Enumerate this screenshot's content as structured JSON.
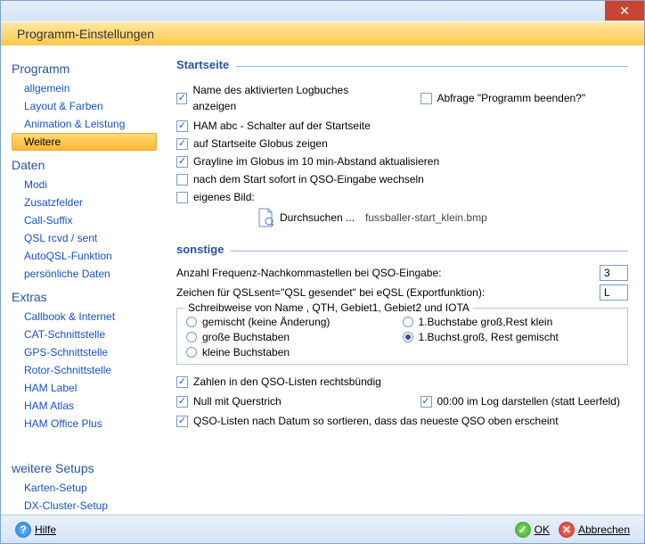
{
  "window": {
    "title": "Programm-Einstellungen"
  },
  "sidebar": {
    "groups": [
      {
        "heading": "Programm",
        "items": [
          {
            "label": "allgemein",
            "selected": false
          },
          {
            "label": "Layout & Farben",
            "selected": false
          },
          {
            "label": "Animation & Leistung",
            "selected": false
          },
          {
            "label": "Weitere",
            "selected": true
          }
        ]
      },
      {
        "heading": "Daten",
        "items": [
          {
            "label": "Modi"
          },
          {
            "label": "Zusatzfelder"
          },
          {
            "label": "Call-Suffix"
          },
          {
            "label": "QSL rcvd / sent"
          },
          {
            "label": "AutoQSL-Funktion"
          },
          {
            "label": "persönliche Daten"
          }
        ]
      },
      {
        "heading": "Extras",
        "items": [
          {
            "label": "Callbook & Internet"
          },
          {
            "label": "CAT-Schnittstelle"
          },
          {
            "label": "GPS-Schnittstelle"
          },
          {
            "label": "Rotor-Schnittstelle"
          },
          {
            "label": "HAM Label"
          },
          {
            "label": "HAM Atlas"
          },
          {
            "label": "HAM Office Plus"
          }
        ]
      },
      {
        "heading": "weitere Setups",
        "items": [
          {
            "label": "Karten-Setup"
          },
          {
            "label": "DX-Cluster-Setup"
          }
        ]
      }
    ]
  },
  "sections": {
    "startseite_title": "Startseite",
    "sonstige_title": "sonstige"
  },
  "startseite": {
    "chk_logbuch": {
      "label": "Name des aktivierten Logbuches anzeigen",
      "checked": true
    },
    "chk_beenden": {
      "label": "Abfrage \"Programm beenden?\"",
      "checked": false
    },
    "chk_hamabc": {
      "label": "HAM abc - Schalter auf der Startseite",
      "checked": true
    },
    "chk_globus": {
      "label": "auf Startseite Globus zeigen",
      "checked": true
    },
    "chk_grayline": {
      "label": "Grayline im Globus im 10 min-Abstand aktualisieren",
      "checked": true
    },
    "chk_qsoeingabe": {
      "label": "nach dem Start sofort in QSO-Eingabe wechseln",
      "checked": false
    },
    "chk_eigenesbild": {
      "label": "eigenes Bild:",
      "checked": false
    },
    "file": {
      "browse_label": "Durchsuchen ...",
      "filename": "fussballer-start_klein.bmp"
    }
  },
  "sonstige": {
    "freq_label": "Anzahl Frequenz-Nachkommastellen bei QSO-Eingabe:",
    "freq_value": "3",
    "qslsent_label": "Zeichen für QSLsent=\"QSL gesendet\" bei eQSL (Exportfunktion):",
    "qslsent_value": "L",
    "group_title": "Schreibweise von Name , QTH, Gebiet1, Gebiet2 und IOTA",
    "radios": {
      "gemischt": "gemischt (keine Änderung)",
      "buchstabe1_rest_klein": "1.Buchstabe groß,Rest klein",
      "grosse": "große Buchstaben",
      "buchst1_rest_gemischt": "1.Buchst.groß, Rest gemischt",
      "kleine": "kleine Buchstaben",
      "selected": "buchst1_rest_gemischt"
    },
    "chk_rechtsbuendig": {
      "label": "Zahlen in den QSO-Listen rechtsbündig",
      "checked": true
    },
    "chk_querstrich": {
      "label": "Null mit Querstrich",
      "checked": true
    },
    "chk_0000": {
      "label": "00:00 im Log darstellen (statt Leerfeld)",
      "checked": true
    },
    "chk_sort": {
      "label": "QSO-Listen nach Datum  so sortieren, dass das neueste QSO oben erscheint",
      "checked": true
    }
  },
  "footer": {
    "hilfe": "Hilfe",
    "ok": "OK",
    "abbrechen": "Abbrechen"
  }
}
